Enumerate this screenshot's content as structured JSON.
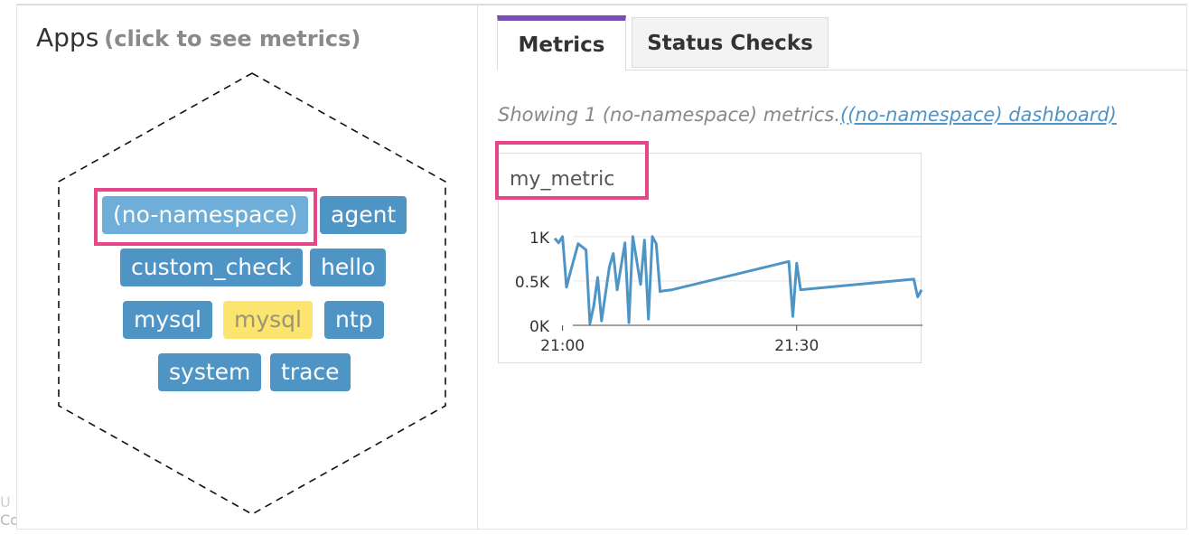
{
  "footer": {
    "partial_text_a": "Copyright ...",
    "partial_text_b": "...",
    "partial_line_top": "U"
  },
  "apps": {
    "title": "Apps",
    "hint": "(click to see metrics)",
    "tags": [
      {
        "label": "(no-namespace)",
        "state": "selected"
      },
      {
        "label": "agent",
        "state": "normal"
      },
      {
        "label": "custom_check",
        "state": "normal"
      },
      {
        "label": "hello",
        "state": "normal"
      },
      {
        "label": "mysql",
        "state": "normal"
      },
      {
        "label": "mysql",
        "state": "warning"
      },
      {
        "label": "ntp",
        "state": "normal"
      },
      {
        "label": "system",
        "state": "normal"
      },
      {
        "label": "trace",
        "state": "normal"
      }
    ]
  },
  "tabs": [
    {
      "label": "Metrics",
      "active": true
    },
    {
      "label": "Status Checks",
      "active": false
    }
  ],
  "metrics": {
    "showing_text": "Showing 1 (no-namespace) metrics.",
    "dashboard_link": "((no-namespace) dashboard)",
    "card_title": "my_metric"
  },
  "colors": {
    "tag_blue": "#4e95c6",
    "tag_selected": "#6eaed8",
    "tag_warning": "#fbe56e",
    "highlight": "#e8468a",
    "tab_accent": "#7a4fb5",
    "line": "#4e95c6"
  },
  "chart_data": {
    "type": "line",
    "series": [
      {
        "x": [
          "20:59",
          "20:59.5",
          "21:00",
          "21:00.5",
          "21:01",
          "21:02",
          "21:03",
          "21:03.5",
          "21:04",
          "21:04.5",
          "21:05",
          "21:06",
          "21:06.5",
          "21:07",
          "21:08",
          "21:08.5",
          "21:09",
          "21:10",
          "21:10.5",
          "21:11",
          "21:11.5",
          "21:12",
          "21:12.5",
          "21:13",
          "21:14",
          "21:29",
          "21:29.5",
          "21:30",
          "21:30.5",
          "21:45",
          "21:45.5",
          "21:46"
        ],
        "y": [
          980,
          930,
          1000,
          430,
          600,
          920,
          850,
          20,
          220,
          540,
          50,
          660,
          810,
          400,
          930,
          30,
          1000,
          460,
          960,
          70,
          1000,
          920,
          380,
          390,
          400,
          720,
          100,
          700,
          400,
          520,
          320,
          400
        ]
      }
    ],
    "xticks": [
      "21:00",
      "21:30"
    ],
    "yticks": [
      "0K",
      "0.5K",
      "1K"
    ],
    "ylim": [
      0,
      1100
    ],
    "grid": true
  }
}
